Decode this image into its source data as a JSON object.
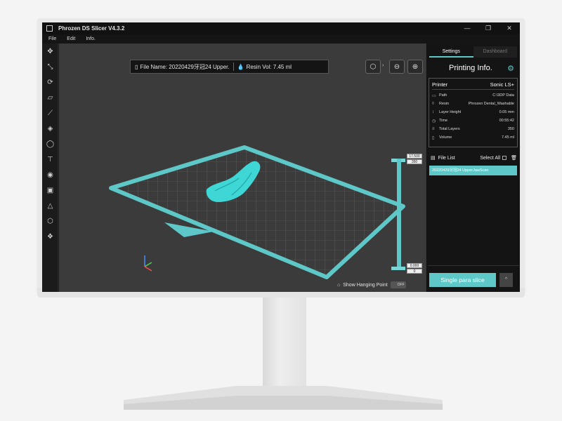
{
  "app": {
    "title": "Phrozen DS Slicer  V4.3.2",
    "window_controls": [
      "—",
      "❐",
      "✕"
    ]
  },
  "menu": [
    "File",
    "Edit",
    "Info."
  ],
  "toolbar_icons": [
    "move-icon",
    "scale-icon",
    "rotate-icon",
    "ruler-icon",
    "support-icon",
    "layers-icon",
    "hollow-icon",
    "drill-icon",
    "ring-icon",
    "square-icon",
    "pyramid-icon",
    "cube-icon",
    "stack-icon"
  ],
  "viewport": {
    "file_name_label": "File Name: 20220429牙冠24 Upper.",
    "resin_vol_label": "Resin Vol: 7.45 ml",
    "slider_top_value": "17.500",
    "slider_top_sub": "350",
    "slider_bottom_value": "0.000",
    "slider_bottom_sub": "0",
    "hanging_label": "Show Hanging Point",
    "hanging_state": "OFF"
  },
  "panel": {
    "tab_settings": "Settings",
    "tab_dashboard": "Dashboard",
    "title": "Printing Info.",
    "printer_label": "Printer",
    "printer_value": "Sonic LS+",
    "rows": [
      {
        "label": "Path",
        "value": "C:\\3DP Data"
      },
      {
        "label": "Resin",
        "value": "Phrozen Dental_Washable"
      },
      {
        "label": "Layer Height",
        "value": "0.05 mm"
      },
      {
        "label": "Time",
        "value": "00:55:42"
      },
      {
        "label": "Total Layers",
        "value": "350"
      },
      {
        "label": "Volume",
        "value": "7.45 ml"
      }
    ],
    "file_list_label": "File List",
    "select_all_label": "Select All",
    "file_item": "20220429牙冠24 UpperJawScan",
    "slice_button": "Single para slice",
    "slice_arrow": "^"
  },
  "colors": {
    "accent": "#5ec8c8",
    "background": "#3b3b3b"
  }
}
